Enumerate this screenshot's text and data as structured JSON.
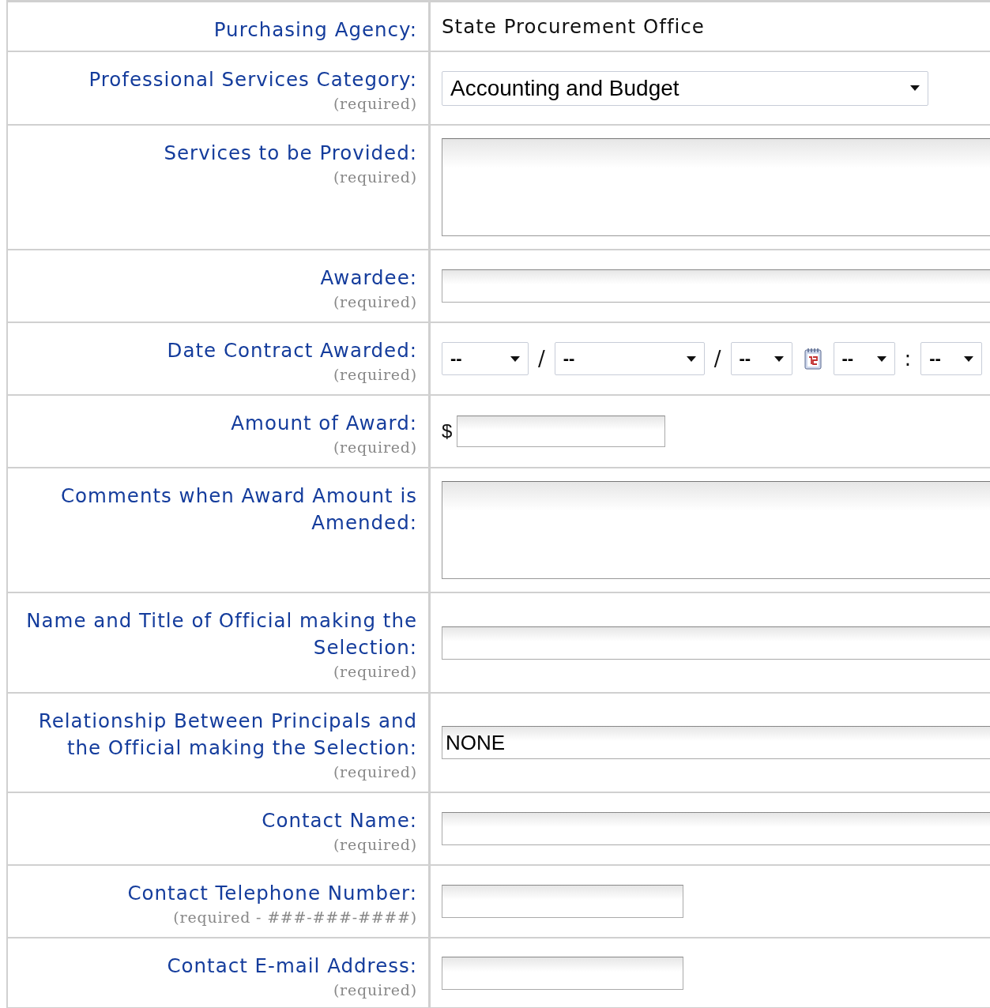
{
  "form_rows": [
    {
      "label": "Purchasing Agency:",
      "field": {
        "kind": "text",
        "value": "State Procurement Office"
      }
    },
    {
      "label": "Professional Services Category:",
      "note": "(required)",
      "field": {
        "kind": "select",
        "value": "Accounting and Budget"
      }
    },
    {
      "label": "Services to be Provided:",
      "note": "(required)",
      "field": {
        "kind": "textarea"
      }
    },
    {
      "label": "Awardee:",
      "note": "(required)",
      "field": {
        "kind": "input"
      }
    },
    {
      "label": "Date Contract Awarded:",
      "note": "(required)",
      "field": {
        "kind": "date",
        "parts": [
          {
            "kind": "medium_select",
            "value": "--"
          },
          {
            "kind": "separator",
            "text": "/"
          },
          {
            "kind": "wide_select",
            "value": "--"
          },
          {
            "kind": "separator",
            "text": "/"
          },
          {
            "kind": "select",
            "value": "--"
          },
          {
            "kind": "calendar"
          },
          {
            "kind": "select",
            "value": "--"
          },
          {
            "kind": "separator",
            "text": ":"
          },
          {
            "kind": "select",
            "value": "--"
          }
        ]
      }
    },
    {
      "label": "Amount of Award:",
      "note": "(required)",
      "field": {
        "kind": "money",
        "prefix": "$"
      }
    },
    {
      "label": "Comments when Award Amount is Amended:",
      "field": {
        "kind": "textarea"
      }
    },
    {
      "label": "Name and Title of Official making the Selection:",
      "note": "(required)",
      "field": {
        "kind": "input"
      }
    },
    {
      "label": "Relationship Between Principals and the Official making the Selection:",
      "note": "(required)",
      "field": {
        "kind": "input",
        "value": "NONE"
      }
    },
    {
      "label": "Contact Name:",
      "note": "(required)",
      "field": {
        "kind": "input"
      }
    },
    {
      "label": "Contact Telephone Number:",
      "note": "(required - ###-###-####)",
      "field": {
        "kind": "short_input"
      }
    },
    {
      "label": "Contact E-mail Address:",
      "note": "(required)",
      "field": {
        "kind": "short_input"
      }
    }
  ]
}
